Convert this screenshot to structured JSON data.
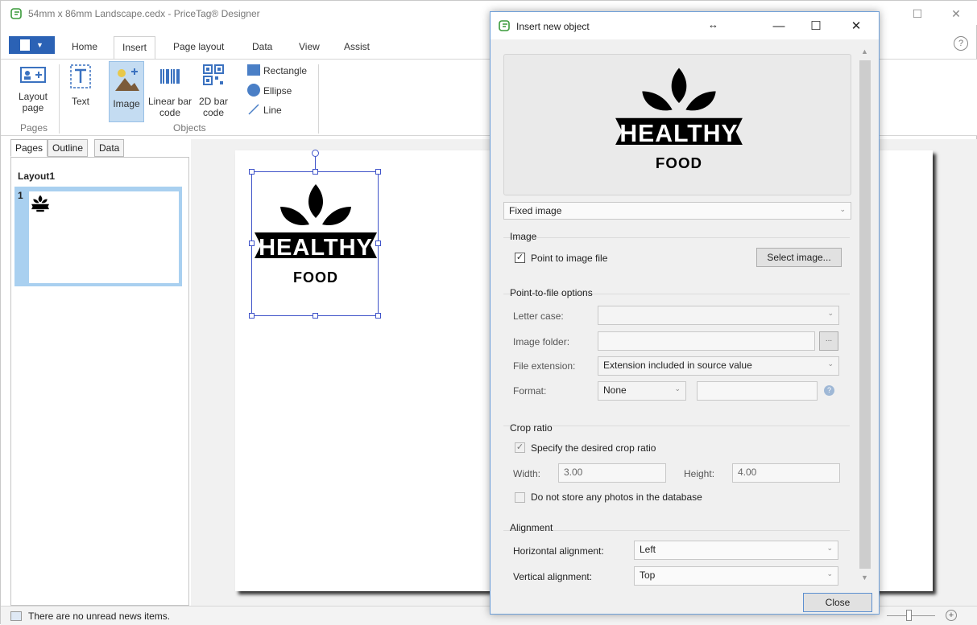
{
  "window": {
    "title": "54mm x 86mm Landscape.cedx - PriceTag® Designer"
  },
  "ribbon": {
    "tabs": [
      "Home",
      "Insert",
      "Page layout",
      "Data",
      "View",
      "Assist"
    ],
    "buttons": {
      "layout_page": "Layout page",
      "text": "Text",
      "image": "Image",
      "linear_bar_code": "Linear bar code",
      "bar_code_2d": "2D bar code",
      "rectangle": "Rectangle",
      "ellipse": "Ellipse",
      "line": "Line"
    },
    "groups": {
      "pages": "Pages",
      "objects": "Objects"
    },
    "help": "?"
  },
  "left_panel": {
    "tabs": [
      "Pages",
      "Outline",
      "Data"
    ],
    "layout_name": "Layout1",
    "page_number": "1"
  },
  "logo": {
    "word1": "HEALTHY",
    "word2": "FOOD"
  },
  "status": {
    "news": "There are no unread news items."
  },
  "dialog": {
    "title": "Insert new object",
    "source_type": "Fixed image",
    "image_section": {
      "label": "Image",
      "point_to_file_label": "Point to image file",
      "point_to_file_checked": true,
      "select_button": "Select image..."
    },
    "options_section": {
      "label": "Point-to-file options",
      "letter_case_label": "Letter case:",
      "letter_case_value": "",
      "image_folder_label": "Image folder:",
      "image_folder_value": "",
      "browse_button": "...",
      "file_extension_label": "File extension:",
      "file_extension_value": "Extension included in source value",
      "format_label": "Format:",
      "format_value": "None"
    },
    "crop_section": {
      "label": "Crop ratio",
      "specify_label": "Specify the desired crop ratio",
      "specify_checked": true,
      "width_label": "Width:",
      "width_value": "3.00",
      "height_label": "Height:",
      "height_value": "4.00",
      "no_store_label": "Do not store any photos in the database",
      "no_store_checked": false
    },
    "alignment_section": {
      "label": "Alignment",
      "horizontal_label": "Horizontal alignment:",
      "horizontal_value": "Left",
      "vertical_label": "Vertical alignment:",
      "vertical_value": "Top"
    },
    "close_button": "Close"
  },
  "colors": {
    "accent": "#2b62b5",
    "selection": "#3f53c9",
    "thumb_highlight": "#a9d0f0"
  }
}
